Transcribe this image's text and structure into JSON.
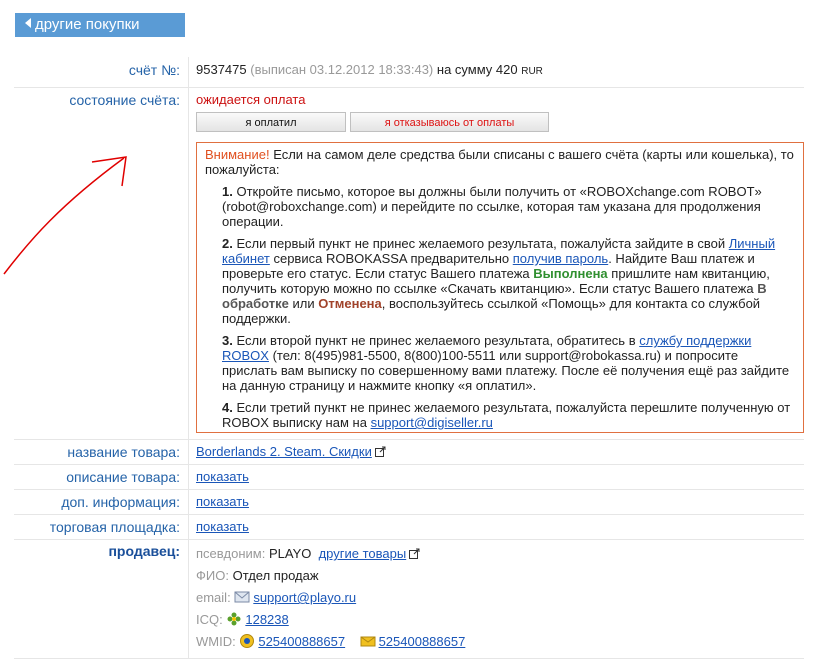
{
  "back_button": {
    "label": "другие покупки"
  },
  "invoice": {
    "label": "счёт №:",
    "number": "9537475",
    "issued": "(выписан 03.12.2012 18:33:43)",
    "amount_text": "на сумму 420",
    "currency": "RUR"
  },
  "state": {
    "label": "состояние счёта:",
    "value": "ожидается оплата",
    "paid_button": "я оплатил",
    "refuse_button": "я отказываюсь от оплаты"
  },
  "warning": {
    "title": "Внимание!",
    "intro": "Если на самом деле средства были списаны с вашего счёта (карты или кошелька), то пожалуйста:",
    "step1": {
      "num": "1.",
      "text": "Откройте письмо, которое вы должны были получить от «ROBOXchange.com ROBOT» (robot@roboxchange.com) и перейдите по ссылке, которая там указана для продолжения операции."
    },
    "step2": {
      "num": "2.",
      "t1": "Если первый пункт не принес желаемого результата, пожалуйста зайдите в свой",
      "link1": "Личный кабинет",
      "t2": "сервиса ROBOKASSA предварительно",
      "link2": "получив пароль",
      "t3": ". Найдите Ваш платеж и проверьте его статус. Если статус Вашего платежа",
      "status_done": "Выполнена",
      "t4": "пришлите нам квитанцию, получить которую можно по ссылке «Скачать квитанцию». Если статус Вашего платежа",
      "status_processing": "В обработке",
      "t5": "или",
      "status_cancelled": "Отменена",
      "t6": ", воспользуйтесь ссылкой «Помощь» для контакта со службой поддержки."
    },
    "step3": {
      "num": "3.",
      "t1": "Если второй пункт не принес желаемого результата, обратитесь в",
      "link": "службу поддержки ROBOX",
      "t2": "(тел: 8(495)981-5500, 8(800)100-5511 или support@robokassa.ru) и попросите прислать вам выписку по совершенному вами платежу. После её получения ещё раз зайдите на данную страницу и нажмите кнопку «я оплатил»."
    },
    "step4": {
      "num": "4.",
      "t1": "Если третий пункт не принес желаемого результата, пожалуйста перешлите полученную от ROBOX выписку нам на",
      "link": "support@digiseller.ru"
    }
  },
  "product": {
    "label": "название товара:",
    "value": "Borderlands 2. Steam. Скидки"
  },
  "description": {
    "label": "описание товара:",
    "link": "показать"
  },
  "extra_info": {
    "label": "доп. информация:",
    "link": "показать"
  },
  "marketplace": {
    "label": "торговая площадка:",
    "link": "показать"
  },
  "seller": {
    "label": "продавец:",
    "alias_label": "псевдоним:",
    "alias": "PLAYO",
    "other_goods": "другие товары",
    "fio_label": "ФИО:",
    "fio": "Отдел продаж",
    "email_label": "email:",
    "email": "support@playo.ru",
    "icq_label": "ICQ:",
    "icq": "128238",
    "wmid_label": "WMID:",
    "wmid1": "525400888657",
    "wmid2": "525400888657"
  },
  "colors": {
    "accent": "#5a9bd5",
    "label": "#2563a8",
    "warning_border": "#e07040",
    "link": "#1a56b8",
    "red": "#cc1111",
    "annotation": "#e00000"
  }
}
